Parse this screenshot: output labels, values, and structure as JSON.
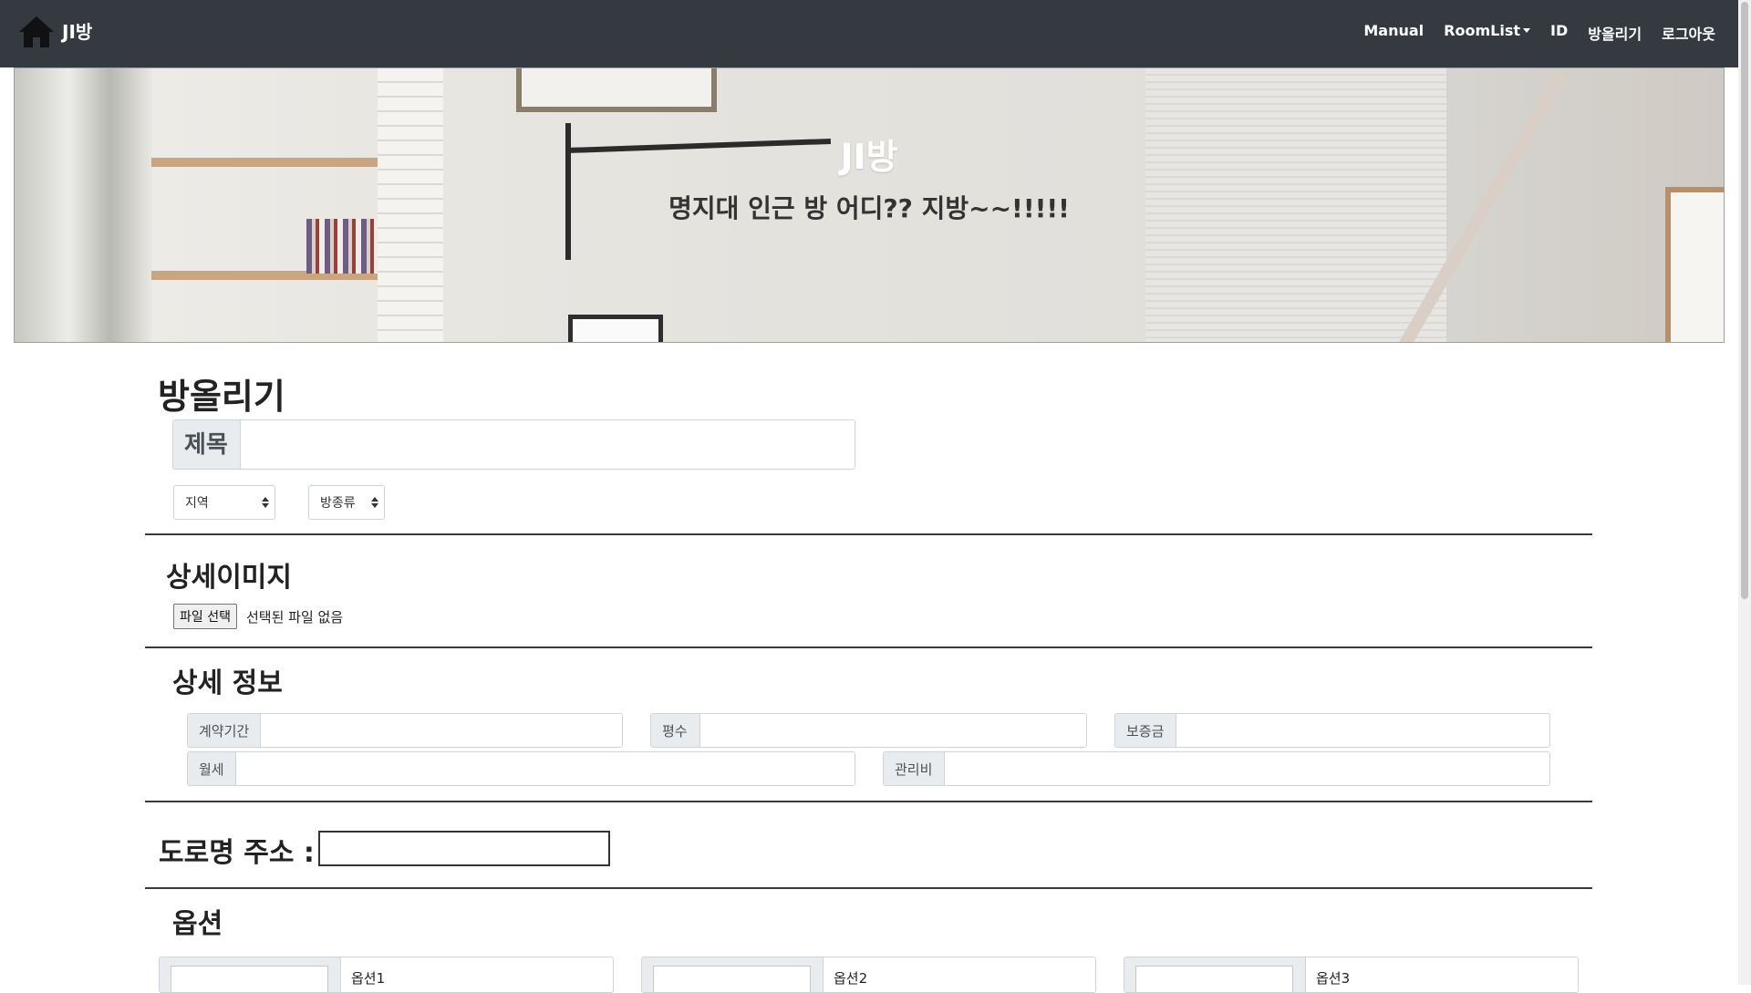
{
  "navbar": {
    "brand": "JI방",
    "items": [
      "Manual",
      "RoomList",
      "ID",
      "방올리기",
      "로그아웃"
    ]
  },
  "hero": {
    "title": "JI방",
    "subtitle": "명지대 인근 방 어디?? 지방~~!!!!!"
  },
  "form": {
    "page_title": "방올리기",
    "title_label": "제목",
    "title_value": "",
    "region_select": "지역",
    "room_type_select": "방종류",
    "image_section": "상세이미지",
    "file_button": "파일 선택",
    "file_status": "선택된 파일 없음",
    "details_section": "상세 정보",
    "fields": {
      "contract": "계약기간",
      "area": "평수",
      "deposit": "보증금",
      "rent": "월세",
      "maintenance": "관리비"
    },
    "address_label": "도로명 주소 :",
    "address_value": "",
    "options_section": "옵션",
    "options": [
      "옵션1",
      "옵션2",
      "옵션3"
    ]
  },
  "colors": {
    "navbar": "#343a40",
    "addon": "#e9ecef"
  }
}
